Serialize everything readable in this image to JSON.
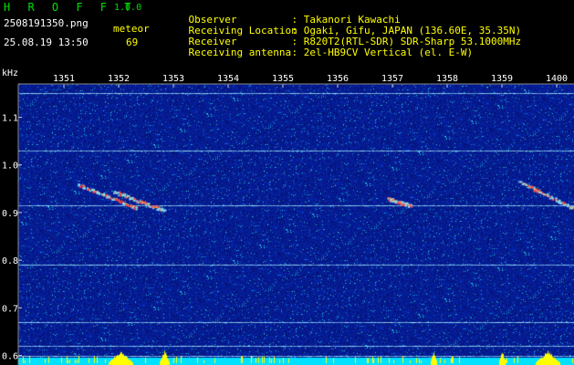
{
  "header": {
    "app_title": "H R O F F T",
    "app_version": "1.0.0",
    "filename": "2508191350.png",
    "meteor_label": "meteor",
    "datetime": "25.08.19 13:50",
    "meteor_count": "69",
    "info": [
      {
        "label": "Observer",
        "value": ": Takanori Kawachi"
      },
      {
        "label": "Receiving Location",
        "value": ": Ogaki, Gifu, JAPAN (136.60E, 35.35N)"
      },
      {
        "label": "Receiver",
        "value": ": R820T2(RTL-SDR) SDR-Sharp 53.1000MHz"
      },
      {
        "label": "Receiving antenna",
        "value": ": 2el-HB9CV Vertical (el. E-W)"
      }
    ]
  },
  "colors": {
    "background": "#000000",
    "spectrum_base": "#0a1a8c",
    "carrier_line": "#9fe8ff",
    "meteor_trail": "#ff4040",
    "bottom_level": "#00e0ff",
    "bottom_peak": "#ffff00",
    "label_green": "#00e000",
    "label_yellow": "#ffff00"
  },
  "chart_data": {
    "type": "heatmap",
    "ylabel": "kHz",
    "xticks": [
      "1351",
      "1352",
      "1353",
      "1354",
      "1355",
      "1356",
      "1357",
      "1358",
      "1359",
      "1400"
    ],
    "yticks": [
      "1.1",
      "1.0",
      "0.9",
      "0.8",
      "0.7",
      "0.6"
    ],
    "ylim": [
      0.58,
      1.17
    ],
    "carrier_lines_khz": [
      1.15,
      1.03,
      0.915,
      0.79,
      0.67,
      0.62,
      0.6
    ],
    "meteor_echoes": [
      {
        "time": "1351-1352",
        "freq_khz": [
          0.96,
          0.91
        ]
      },
      {
        "time": "1352",
        "freq_khz": [
          0.94,
          0.905
        ]
      },
      {
        "time": "1357",
        "freq_khz": [
          0.935,
          0.915
        ]
      },
      {
        "time": "1359-1400",
        "freq_khz": [
          0.96,
          0.91
        ]
      }
    ]
  }
}
